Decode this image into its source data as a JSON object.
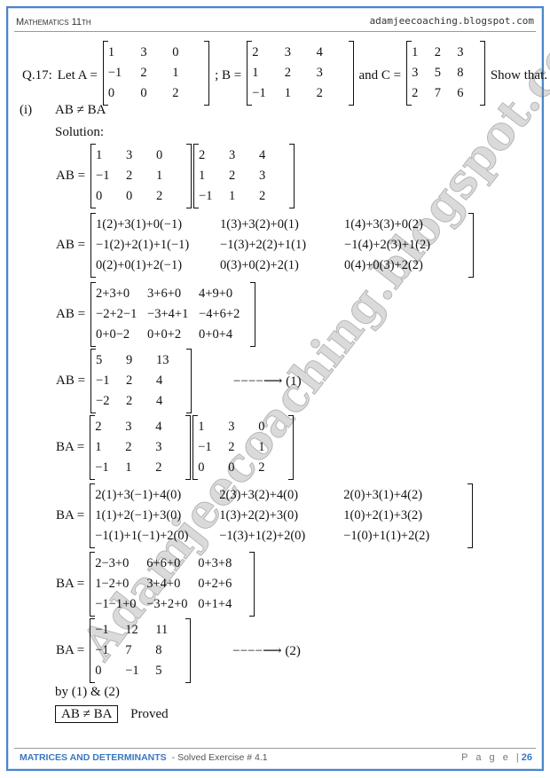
{
  "header": {
    "subject": "Mathematics 11th",
    "site": "adamjeecoaching.blogspot.com"
  },
  "footer": {
    "chapter": "MATRICES AND DETERMINANTS",
    "exercise": "- Solved Exercise # 4.1",
    "page_label": "P a g e |",
    "page_number": "26"
  },
  "watermark": "Adamjeecoaching.blogspot.com",
  "question": {
    "number": "Q.17:",
    "let": "Let A =",
    "sep": ";  B =",
    "and": "and C =",
    "tail": "Show that.",
    "A": [
      [
        "1",
        "3",
        "0"
      ],
      [
        "−1",
        "2",
        "1"
      ],
      [
        "0",
        "0",
        "2"
      ]
    ],
    "B": [
      [
        "2",
        "3",
        "4"
      ],
      [
        "1",
        "2",
        "3"
      ],
      [
        "−1",
        "1",
        "2"
      ]
    ],
    "C": [
      [
        "1",
        "2",
        "3"
      ],
      [
        "3",
        "5",
        "8"
      ],
      [
        "2",
        "7",
        "6"
      ]
    ]
  },
  "part": {
    "label": "(i)",
    "statement": "AB ≠ BA",
    "solution": "Solution:"
  },
  "steps": [
    {
      "lhs": "AB =",
      "matrices": [
        [
          [
            "1",
            "3",
            "0"
          ],
          [
            "−1",
            "2",
            "1"
          ],
          [
            "0",
            "0",
            "2"
          ]
        ],
        [
          [
            "2",
            "3",
            "4"
          ],
          [
            "1",
            "2",
            "3"
          ],
          [
            "−1",
            "1",
            "2"
          ]
        ]
      ],
      "note": ""
    },
    {
      "lhs": "AB =",
      "matrices": [
        [
          [
            "1(2)+3(1)+0(−1)",
            "1(3)+3(2)+0(1)",
            "1(4)+3(3)+0(2)"
          ],
          [
            "−1(2)+2(1)+1(−1)",
            "−1(3)+2(2)+1(1)",
            "−1(4)+2(3)+1(2)"
          ],
          [
            "0(2)+0(1)+2(−1)",
            "0(3)+0(2)+2(1)",
            "0(4)+0(3)+2(2)"
          ]
        ]
      ],
      "note": ""
    },
    {
      "lhs": "AB =",
      "matrices": [
        [
          [
            "2+3+0",
            "3+6+0",
            "4+9+0"
          ],
          [
            "−2+2−1",
            "−3+4+1",
            "−4+6+2"
          ],
          [
            "0+0−2",
            "0+0+2",
            "0+0+4"
          ]
        ]
      ],
      "note": ""
    },
    {
      "lhs": "AB =",
      "matrices": [
        [
          [
            "5",
            "9",
            "13"
          ],
          [
            "−1",
            "2",
            "4"
          ],
          [
            "−2",
            "2",
            "4"
          ]
        ]
      ],
      "note": "−−−−⟶  (1)"
    },
    {
      "lhs": "BA =",
      "matrices": [
        [
          [
            "2",
            "3",
            "4"
          ],
          [
            "1",
            "2",
            "3"
          ],
          [
            "−1",
            "1",
            "2"
          ]
        ],
        [
          [
            "1",
            "3",
            "0"
          ],
          [
            "−1",
            "2",
            "1"
          ],
          [
            "0",
            "0",
            "2"
          ]
        ]
      ],
      "note": ""
    },
    {
      "lhs": "BA =",
      "matrices": [
        [
          [
            "2(1)+3(−1)+4(0)",
            "2(3)+3(2)+4(0)",
            "2(0)+3(1)+4(2)"
          ],
          [
            "1(1)+2(−1)+3(0)",
            "1(3)+2(2)+3(0)",
            "1(0)+2(1)+3(2)"
          ],
          [
            "−1(1)+1(−1)+2(0)",
            "−1(3)+1(2)+2(0)",
            "−1(0)+1(1)+2(2)"
          ]
        ]
      ],
      "note": ""
    },
    {
      "lhs": "BA =",
      "matrices": [
        [
          [
            "2−3+0",
            "6+6+0",
            "0+3+8"
          ],
          [
            "1−2+0",
            "3+4+0",
            "0+2+6"
          ],
          [
            "−1−1+0",
            "−3+2+0",
            "0+1+4"
          ]
        ]
      ],
      "note": ""
    },
    {
      "lhs": "BA =",
      "matrices": [
        [
          [
            "−1",
            "12",
            "11"
          ],
          [
            "−1",
            "7",
            "8"
          ],
          [
            "0",
            "−1",
            "5"
          ]
        ]
      ],
      "note": "−−−−⟶  (2)"
    }
  ],
  "conclusion": {
    "by": "by (1) & (2)",
    "result": "AB ≠ BA",
    "proved": "Proved"
  }
}
